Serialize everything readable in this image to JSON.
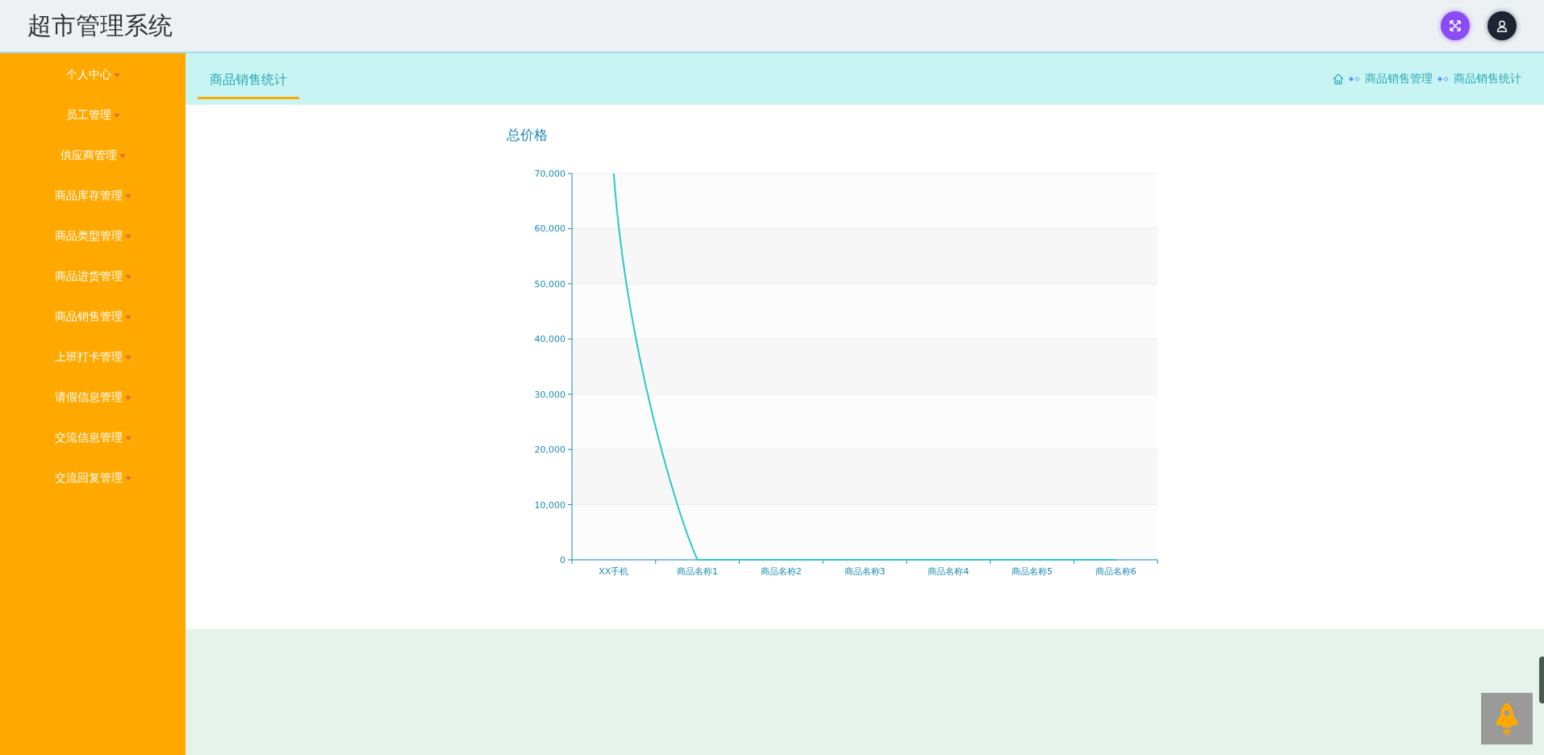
{
  "header": {
    "title": "超市管理系统"
  },
  "sidebar": {
    "items": [
      {
        "label": "个人中心"
      },
      {
        "label": "员工管理"
      },
      {
        "label": "供应商管理"
      },
      {
        "label": "商品库存管理"
      },
      {
        "label": "商品类型管理"
      },
      {
        "label": "商品进货管理"
      },
      {
        "label": "商品销售管理"
      },
      {
        "label": "上班打卡管理"
      },
      {
        "label": "请假信息管理"
      },
      {
        "label": "交流信息管理"
      },
      {
        "label": "交流回复管理"
      }
    ]
  },
  "tabs": [
    {
      "label": "商品销售统计",
      "selected": true
    }
  ],
  "breadcrumb": [
    "商品销售管理",
    "商品销售统计"
  ],
  "chart": {
    "chart_data": {
      "type": "line",
      "title": "总价格",
      "categories": [
        "XX手机",
        "商品名称1",
        "商品名称2",
        "商品名称3",
        "商品名称4",
        "商品名称5",
        "商品名称6"
      ],
      "series": [
        {
          "color": "#2ec7c9",
          "values": [
            70000,
            0,
            0,
            0,
            0,
            0,
            0
          ]
        }
      ],
      "grid": true,
      "ylim": [
        0,
        70000
      ],
      "yticks": [
        {
          "value": 0,
          "label": "0"
        },
        {
          "value": 10000,
          "label": "10,000"
        },
        {
          "value": 20000,
          "label": "20,000"
        },
        {
          "value": 30000,
          "label": "30,000"
        },
        {
          "value": 40000,
          "label": "40,000"
        },
        {
          "value": 50000,
          "label": "50,000"
        },
        {
          "value": 60000,
          "label": "60,000"
        },
        {
          "value": 70000,
          "label": "70,000"
        }
      ]
    }
  }
}
